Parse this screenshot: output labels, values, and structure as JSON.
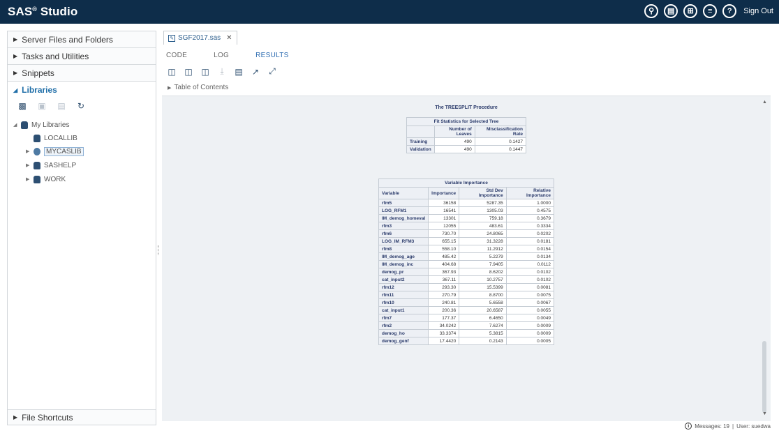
{
  "app": {
    "brand": "SAS",
    "brand_mark": "®",
    "brand_suffix": " Studio",
    "sign_out": "Sign Out"
  },
  "header_icons": [
    "search-icon",
    "open-icon",
    "apps-icon",
    "menu-icon",
    "help-icon"
  ],
  "sidebar": {
    "sections": [
      {
        "label": "Server Files and Folders"
      },
      {
        "label": "Tasks and Utilities"
      },
      {
        "label": "Snippets"
      }
    ],
    "libraries_label": "Libraries",
    "tree_root": "My Libraries",
    "tree_items": [
      "LOCALLIB",
      "MYCASLIB",
      "SASHELP",
      "WORK"
    ],
    "footer_label": "File Shortcuts"
  },
  "editor": {
    "file_tab": "SGF2017.sas",
    "subtabs": [
      "CODE",
      "LOG",
      "RESULTS"
    ],
    "toc_label": "Table of Contents"
  },
  "report": {
    "proc_title": "The TREESPLIT Procedure",
    "fit": {
      "caption": "Fit Statistics for Selected Tree",
      "col_number": "Number of Leaves",
      "col_misclass": "Misclassification Rate",
      "rows": [
        {
          "label": "Training",
          "leaves": "490",
          "rate": "0.1427"
        },
        {
          "label": "Validation",
          "leaves": "490",
          "rate": "0.1447"
        }
      ]
    },
    "varimp": {
      "caption": "Variable Importance",
      "col_variable": "Variable",
      "col_importance": "Importance",
      "col_stddev": "Std Dev Importance",
      "col_relative": "Relative Importance",
      "rows": [
        [
          "rfm5",
          "36158",
          "5287.35",
          "1.0000"
        ],
        [
          "LOG_RFM1",
          "16541",
          "1305.03",
          "0.4575"
        ],
        [
          "IM_demog_homeval",
          "13301",
          "759.18",
          "0.3679"
        ],
        [
          "rfm3",
          "12055",
          "483.61",
          "0.3334"
        ],
        [
          "rfm6",
          "730.70",
          "24.8065",
          "0.0202"
        ],
        [
          "LOG_IM_RFM3",
          "655.15",
          "31.3228",
          "0.0181"
        ],
        [
          "rfm8",
          "558.10",
          "11.2912",
          "0.0154"
        ],
        [
          "IM_demog_age",
          "485.42",
          "5.2279",
          "0.0134"
        ],
        [
          "IM_demog_inc",
          "404.68",
          "7.9405",
          "0.0112"
        ],
        [
          "demog_pr",
          "367.93",
          "8.6202",
          "0.0102"
        ],
        [
          "cat_input2",
          "367.11",
          "10.2757",
          "0.0102"
        ],
        [
          "rfm12",
          "293.30",
          "15.5399",
          "0.0081"
        ],
        [
          "rfm11",
          "270.79",
          "8.8700",
          "0.0075"
        ],
        [
          "rfm10",
          "240.81",
          "5.6558",
          "0.0067"
        ],
        [
          "cat_input1",
          "200.36",
          "20.6587",
          "0.0055"
        ],
        [
          "rfm7",
          "177.37",
          "6.4650",
          "0.0049"
        ],
        [
          "rfm2",
          "34.0242",
          "7.6274",
          "0.0009"
        ],
        [
          "demog_ho",
          "33.3374",
          "5.3815",
          "0.0009"
        ],
        [
          "demog_genf",
          "17.4420",
          "0.2143",
          "0.0005"
        ]
      ]
    }
  },
  "status": {
    "messages": "Messages: 19",
    "user": "User: suedwa"
  }
}
